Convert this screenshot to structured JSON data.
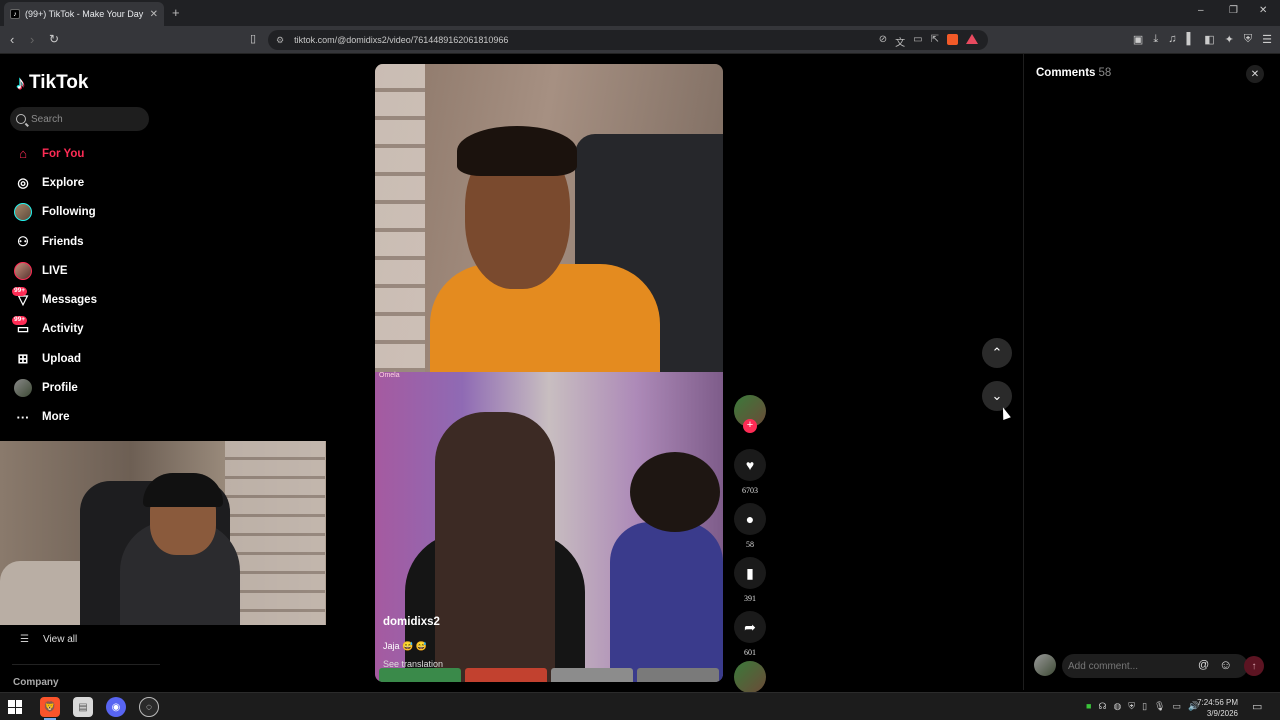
{
  "browser": {
    "tab_title": "(99+) TikTok - Make Your Day",
    "tab_favicon": "tiktok-icon",
    "tab_close": "✕",
    "new_tab": "+",
    "url": "tiktok.com/@domidixs2/video/7614489162061810966",
    "window_controls": [
      "–",
      "❐",
      "✕"
    ]
  },
  "sidebar": {
    "logo_text": "TikTok",
    "search_placeholder": "Search",
    "items": [
      {
        "label": "For You",
        "icon": "home-icon",
        "active": true
      },
      {
        "label": "Explore",
        "icon": "compass-icon"
      },
      {
        "label": "Following",
        "icon": "following-avatar-icon"
      },
      {
        "label": "Friends",
        "icon": "friends-icon"
      },
      {
        "label": "LIVE",
        "icon": "live-avatar-icon"
      },
      {
        "label": "Messages",
        "icon": "messages-icon",
        "badge": "99+"
      },
      {
        "label": "Activity",
        "icon": "activity-icon",
        "badge": "99+"
      },
      {
        "label": "Upload",
        "icon": "upload-icon"
      },
      {
        "label": "Profile",
        "icon": "profile-avatar-icon"
      },
      {
        "label": "More",
        "icon": "more-icon"
      }
    ],
    "view_all": "View all",
    "company": "Company"
  },
  "video": {
    "author": "domidixs2",
    "caption": "Jaja 😅 😅",
    "see_translation": "See translation",
    "overlay_watermark": "Omela"
  },
  "actions": {
    "likes": "6703",
    "comments": "58",
    "bookmarks": "391",
    "shares": "601"
  },
  "comments_panel": {
    "title": "Comments",
    "count": "58",
    "input_placeholder": "Add comment...",
    "mention_icon": "@",
    "emoji_icon": "☺",
    "post_icon": "↑"
  },
  "taskbar": {
    "time": "7:24:56 PM",
    "date": "3/9/2026"
  },
  "colors": {
    "accent": "#fe2c55",
    "background": "#000000",
    "panel": "#1e1e1e"
  }
}
